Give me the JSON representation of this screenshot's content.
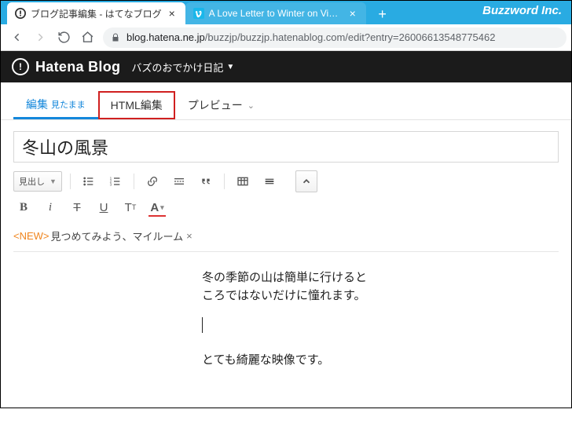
{
  "browser": {
    "branding": "Buzzword Inc.",
    "tabs": [
      {
        "title": "ブログ記事編集 - はてなブログ",
        "active": true
      },
      {
        "title": "A Love Letter to Winter on Vimeo",
        "active": false
      }
    ],
    "url_prefix": "blog.hatena.ne.jp",
    "url_rest": "/buzzjp/buzzjp.hatenablog.com/edit?entry=26006613548775462"
  },
  "site": {
    "logo": "Hatena Blog",
    "blog_name": "バズのおでかけ日記"
  },
  "editor_tabs": {
    "edit": "編集",
    "edit_sub": "見たまま",
    "html": "HTML編集",
    "preview": "プレビュー"
  },
  "post": {
    "title": "冬山の風景",
    "heading_select": "見出し",
    "tag_new": "<NEW>",
    "tag_text": "見つめてみよう、マイルーム",
    "para1": "冬の季節の山は簡単に行けるところではないだけに憧れます。",
    "para2": "とても綺麗な映像です。"
  }
}
